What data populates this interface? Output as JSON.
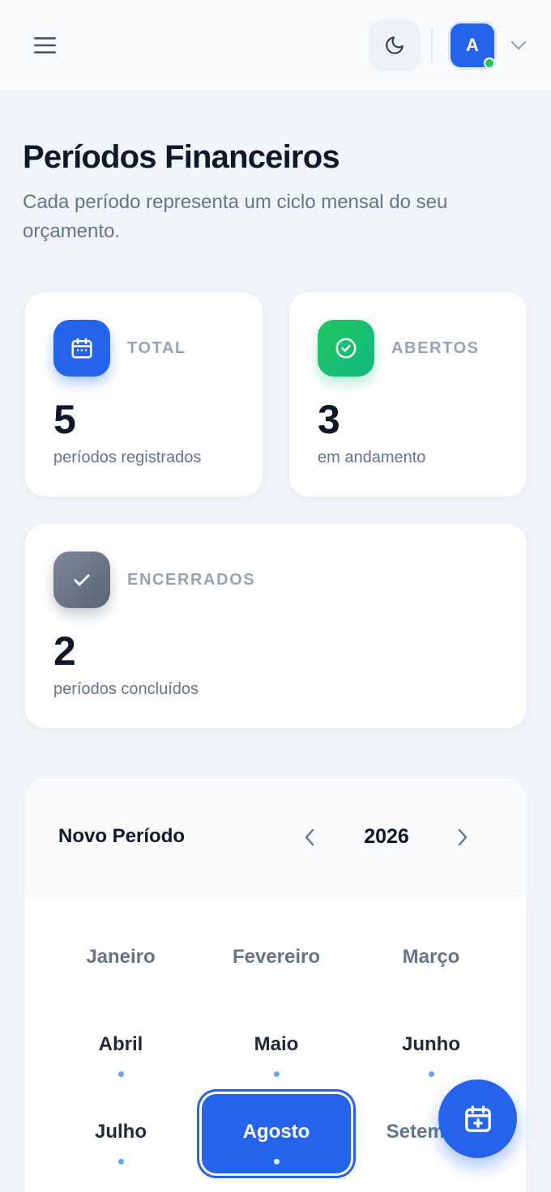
{
  "header": {
    "menu_icon": "hamburger-menu-icon",
    "theme_icon": "moon-icon",
    "avatar_initial": "A",
    "status_color": "#22c55e",
    "dropdown_icon": "chevron-down-icon"
  },
  "page": {
    "title": "Períodos Financeiros",
    "subtitle": "Cada período representa um ciclo mensal do seu orçamento."
  },
  "stats": {
    "total": {
      "label": "TOTAL",
      "value": "5",
      "desc": "períodos registrados",
      "icon": "calendar-icon",
      "color": "#2563eb"
    },
    "open": {
      "label": "ABERTOS",
      "value": "3",
      "desc": "em andamento",
      "icon": "check-circle-icon",
      "color": "#10b981"
    },
    "closed": {
      "label": "ENCERRADOS",
      "value": "2",
      "desc": "períodos concluídos",
      "icon": "check-icon",
      "color": "#64748b"
    }
  },
  "picker": {
    "title": "Novo Período",
    "year": "2026",
    "months": [
      {
        "label": "Janeiro",
        "has_dot": false,
        "state": "muted"
      },
      {
        "label": "Fevereiro",
        "has_dot": false,
        "state": "muted"
      },
      {
        "label": "Março",
        "has_dot": false,
        "state": "muted"
      },
      {
        "label": "Abril",
        "has_dot": true,
        "state": "dark"
      },
      {
        "label": "Maio",
        "has_dot": true,
        "state": "dark"
      },
      {
        "label": "Junho",
        "has_dot": true,
        "state": "dark"
      },
      {
        "label": "Julho",
        "has_dot": true,
        "state": "dark"
      },
      {
        "label": "Agosto",
        "has_dot": true,
        "state": "selected"
      },
      {
        "label": "Setembro",
        "has_dot": false,
        "state": "muted"
      }
    ]
  },
  "fab": {
    "icon": "calendar-plus-icon"
  },
  "colors": {
    "accent": "#2563eb",
    "background": "#f1f5f9"
  }
}
